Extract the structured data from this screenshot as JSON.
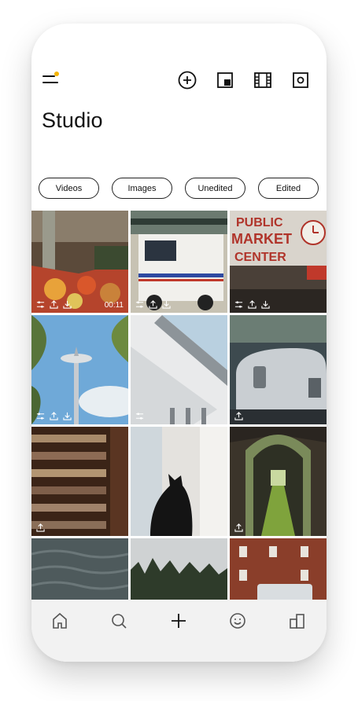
{
  "header": {
    "title": "Studio",
    "icons": [
      "menu-icon",
      "add-circle-icon",
      "picture-in-picture-icon",
      "film-icon",
      "camera-icon"
    ],
    "accent": "#f5b400"
  },
  "filters": [
    "Videos",
    "Images",
    "Unedited",
    "Edited"
  ],
  "media": [
    {
      "name": "market-produce",
      "badges": [
        "adjust",
        "share",
        "download"
      ],
      "duration": "00:11"
    },
    {
      "name": "delivery-truck",
      "badges": [
        "adjust",
        "share",
        "download"
      ]
    },
    {
      "name": "public-market-sign",
      "badges": [
        "adjust",
        "share",
        "download"
      ]
    },
    {
      "name": "space-needle",
      "badges": [
        "adjust",
        "share",
        "download"
      ]
    },
    {
      "name": "modern-building",
      "badges": [
        "adjust"
      ]
    },
    {
      "name": "airstream-trailer",
      "badges": [
        "share"
      ]
    },
    {
      "name": "bookstore",
      "badges": [
        "share"
      ]
    },
    {
      "name": "black-cat",
      "badges": []
    },
    {
      "name": "forest-path",
      "badges": [
        "share"
      ]
    },
    {
      "name": "water",
      "badges": []
    },
    {
      "name": "treeline",
      "badges": []
    },
    {
      "name": "brick-building",
      "badges": []
    }
  ],
  "tabbar": [
    "home-icon",
    "search-icon",
    "plus-icon",
    "smile-icon",
    "library-icon"
  ]
}
